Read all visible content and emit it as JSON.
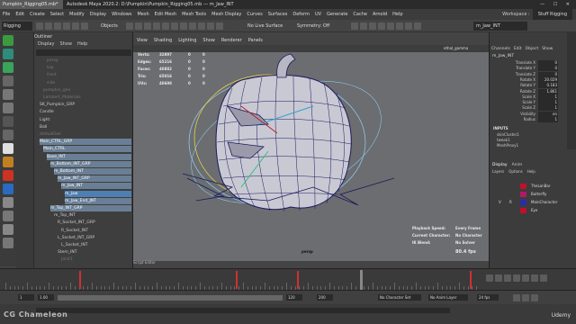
{
  "window": {
    "tab_label": "Pumpkin_Rigging05.mb*",
    "title": "Autodesk Maya 2020.2: D:\\Pumpkin\\Pumpkin_Rigging05.mb    ---    m_Jaw_INT",
    "controls": "— ☐ ✕"
  },
  "menu": [
    "File",
    "Edit",
    "Create",
    "Select",
    "Modify",
    "Display",
    "Windows",
    "Mesh",
    "Edit Mesh",
    "Mesh Tools",
    "Mesh Display",
    "Curves",
    "Surfaces",
    "Deform",
    "UV",
    "Generate",
    "Cache",
    "Arnold",
    "Help"
  ],
  "workspace": {
    "label": "Workspace :",
    "value": "Stuff Rigging"
  },
  "statusline": {
    "mode": "Rigging",
    "objects": "Objects",
    "no_live": "No Live Surface",
    "symmetry": "Symmetry: Off",
    "selection_field": "m_Jaw_INT"
  },
  "outliner": {
    "title": "Outliner",
    "menu": [
      "Display",
      "Show",
      "Help"
    ],
    "items": [
      {
        "label": "persp",
        "indent": 3,
        "state": "dim"
      },
      {
        "label": "top",
        "indent": 3,
        "state": "dim"
      },
      {
        "label": "front",
        "indent": 3,
        "state": "dim"
      },
      {
        "label": "side",
        "indent": 3,
        "state": "dim"
      },
      {
        "label": "pumpkin_geo",
        "indent": 2,
        "state": "dim"
      },
      {
        "label": "Lambert_Materials",
        "indent": 2,
        "state": "dim"
      },
      {
        "label": "SK_Pumpkin_GRP",
        "indent": 1,
        "state": "normal"
      },
      {
        "label": "Candle",
        "indent": 1,
        "state": "normal"
      },
      {
        "label": "Light",
        "indent": 1,
        "state": "normal"
      },
      {
        "label": "Ball",
        "indent": 1,
        "state": "normal"
      },
      {
        "label": "defaultSet",
        "indent": 1,
        "state": "dim"
      },
      {
        "label": "Main_CTRL_GRP",
        "indent": 1,
        "state": "sel-light"
      },
      {
        "label": "Main_CTRL",
        "indent": 2,
        "state": "sel-light"
      },
      {
        "label": "Base_INT",
        "indent": 3,
        "state": "sel-light"
      },
      {
        "label": "m_Bottom_INT_GRP",
        "indent": 4,
        "state": "sel-light"
      },
      {
        "label": "m_Bottom_INT",
        "indent": 5,
        "state": "sel-light"
      },
      {
        "label": "m_Jaw_INT_GRP",
        "indent": 6,
        "state": "sel-light"
      },
      {
        "label": "m_Jaw_INT",
        "indent": 7,
        "state": "sel-light"
      },
      {
        "label": "m_Jaw",
        "indent": 8,
        "state": "sel"
      },
      {
        "label": "m_Jaw_End_JNT",
        "indent": 8,
        "state": "sel-light"
      },
      {
        "label": "m_Top_INT_GRP",
        "indent": 4,
        "state": "sel-light"
      },
      {
        "label": "m_Top_INT",
        "indent": 5,
        "state": "normal"
      },
      {
        "label": "R_Socket_INT_GRP",
        "indent": 6,
        "state": "normal"
      },
      {
        "label": "R_Socket_INT",
        "indent": 7,
        "state": "normal"
      },
      {
        "label": "L_Socket_INT_GRP",
        "indent": 6,
        "state": "normal"
      },
      {
        "label": "L_Socket_INT",
        "indent": 7,
        "state": "normal"
      },
      {
        "label": "Stem_INT",
        "indent": 6,
        "state": "normal"
      },
      {
        "label": "Joint1",
        "indent": 7,
        "state": "dim"
      }
    ]
  },
  "viewport": {
    "menu": [
      "View",
      "Shading",
      "Lighting",
      "Show",
      "Renderer",
      "Panels"
    ],
    "camera": "persp",
    "cam_field": "ethal_gamma",
    "hud_stats": [
      {
        "label": "Verts:",
        "a": "32897",
        "b": "0",
        "c": "0"
      },
      {
        "label": "Edges:",
        "a": "65216",
        "b": "0",
        "c": "0"
      },
      {
        "label": "Faces:",
        "a": "40882",
        "b": "0",
        "c": "0"
      },
      {
        "label": "Tris:",
        "a": "65016",
        "b": "0",
        "c": "0"
      },
      {
        "label": "UVs:",
        "a": "40698",
        "b": "0",
        "c": "0"
      }
    ],
    "hud_info": [
      {
        "label": "Playback Speed:",
        "value": "Every Frame"
      },
      {
        "label": "Current Character:",
        "value": "No Character"
      },
      {
        "label": "IK Blend:",
        "value": "No Solver"
      }
    ],
    "fps": "80.4 fps",
    "colors": {
      "wire": "#1a1a5c",
      "ring": "#7ec0e6",
      "ring_yellow": "#e6d24a"
    }
  },
  "channels": {
    "tabs": [
      "Channels",
      "Edit",
      "Object",
      "Show"
    ],
    "object": "m_Jaw_INT",
    "attrs": [
      {
        "label": "Translate X",
        "value": "0"
      },
      {
        "label": "Translate Y",
        "value": "0"
      },
      {
        "label": "Translate Z",
        "value": "0"
      },
      {
        "label": "Rotate X",
        "value": "20.029"
      },
      {
        "label": "Rotate Y",
        "value": "0.183"
      },
      {
        "label": "Rotate Z",
        "value": "1.861"
      },
      {
        "label": "Scale X",
        "value": "1"
      },
      {
        "label": "Scale Y",
        "value": "1"
      },
      {
        "label": "Scale Z",
        "value": "1"
      },
      {
        "label": "Visibility",
        "value": "on"
      },
      {
        "label": "Radius",
        "value": "1"
      }
    ],
    "inputs_title": "INPUTS",
    "inputs": [
      "skinCluster1",
      "tweak1"
    ],
    "outputs": [
      "MeshProxy1"
    ],
    "layer_tabs": [
      "Display",
      "Anim"
    ],
    "layer_menu": [
      "Layers",
      "Options",
      "Help"
    ],
    "layers": [
      {
        "name": "TheLanBar",
        "color": "#c0102a",
        "v": "",
        "p": ""
      },
      {
        "name": "Butterfly",
        "color": "#b01a6a",
        "v": "",
        "p": ""
      },
      {
        "name": "MainCharacter",
        "color": "#2a2ab0",
        "v": "V",
        "p": "R"
      },
      {
        "name": "Eye",
        "color": "#c0102a",
        "v": "",
        "p": ""
      }
    ]
  },
  "timeline": {
    "script_editor": "Script Editor",
    "start": "1",
    "end": "120",
    "range_start": "1.00",
    "range_end": "200",
    "current": "97",
    "no_character": "No Character Set",
    "no_anim_layer": "No Anim Layer",
    "fps_setting": "24 fps",
    "mode_label": "MEL"
  },
  "watermark": "CG Chameleon",
  "brand": "Udemy"
}
